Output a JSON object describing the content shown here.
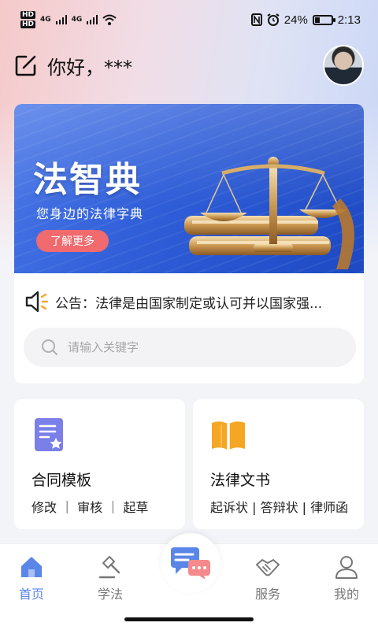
{
  "status_bar": {
    "hd1": "HD",
    "hd2": "HD",
    "signal1": "4G",
    "signal2": "4G",
    "battery": "24%",
    "time": "2:13"
  },
  "header": {
    "greeting": "你好，***"
  },
  "banner": {
    "title": "法智典",
    "subtitle": "您身边的法律字典",
    "button_label": "了解更多"
  },
  "notice": {
    "text": "公告：法律是由国家制定或认可并以国家强..."
  },
  "search": {
    "placeholder": "请输入关键字"
  },
  "features": [
    {
      "title": "合同模板",
      "subtitle": "修改  ｜  审核  ｜  起草",
      "icon": "document-star-icon"
    },
    {
      "title": "法律文书",
      "subtitle": "起诉状 | 答辩状 | 律师函",
      "icon": "open-book-icon"
    }
  ],
  "nav": {
    "items": [
      {
        "label": "首页",
        "icon": "home-icon",
        "active": true
      },
      {
        "label": "学法",
        "icon": "gavel-icon",
        "active": false
      },
      {
        "label": "",
        "icon": "chat-icon",
        "active": false
      },
      {
        "label": "服务",
        "icon": "handshake-icon",
        "active": false
      },
      {
        "label": "我的",
        "icon": "user-icon",
        "active": false
      }
    ]
  },
  "colors": {
    "accent": "#5a86e8",
    "banner_button": "#f06a6e",
    "template_icon": "#7b7fe8",
    "book_icon": "#f5a623"
  }
}
